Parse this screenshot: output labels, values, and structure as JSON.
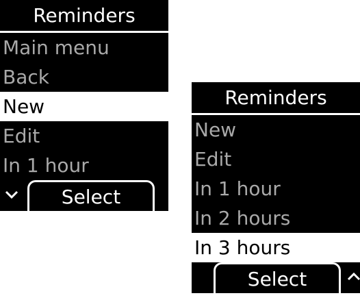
{
  "screen1": {
    "title": "Reminders",
    "items": [
      {
        "label": "Main menu",
        "selected": false
      },
      {
        "label": "Back",
        "selected": false
      },
      {
        "label": "New",
        "selected": true
      },
      {
        "label": "Edit",
        "selected": false
      },
      {
        "label": "In 1 hour",
        "selected": false
      }
    ],
    "softkey": {
      "label": "Select"
    },
    "scroll_icon": "chevron-down-icon"
  },
  "screen2": {
    "title": "Reminders",
    "items": [
      {
        "label": "New",
        "selected": false
      },
      {
        "label": "Edit",
        "selected": false
      },
      {
        "label": "In 1 hour",
        "selected": false
      },
      {
        "label": "In 2 hours",
        "selected": false
      },
      {
        "label": "In 3 hours",
        "selected": true
      }
    ],
    "softkey": {
      "label": "Select"
    },
    "scroll_icon": "chevron-up-icon"
  },
  "colors": {
    "background": "#000000",
    "text_selected": "#000000",
    "text_dim": "#a9a9a9",
    "highlight": "#ffffff"
  }
}
